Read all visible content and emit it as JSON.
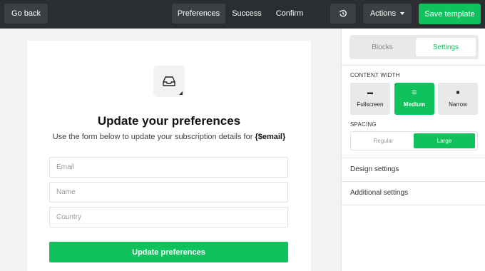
{
  "topbar": {
    "go_back": "Go back",
    "tabs": [
      {
        "label": "Preferences",
        "active": true
      },
      {
        "label": "Success",
        "active": false
      },
      {
        "label": "Confirm",
        "active": false
      }
    ],
    "actions": "Actions",
    "save": "Save template"
  },
  "canvas": {
    "icon": "inbox-icon",
    "title": "Update your preferences",
    "subtitle": "Use the form below to update your subscription details for",
    "subtitle_var": "{$email}",
    "fields": {
      "email": "Email",
      "name": "Name",
      "country": "Country"
    },
    "submit": "Update preferences"
  },
  "panel": {
    "tabs": {
      "blocks": "Blocks",
      "settings": "Settings"
    },
    "content_width_label": "CONTENT WIDTH",
    "content_width": {
      "fullscreen": "Fullscreen",
      "medium": "Medium",
      "narrow": "Narrow",
      "selected": "Medium"
    },
    "spacing_label": "SPACING",
    "spacing": {
      "regular": "Regular",
      "large": "Large",
      "selected": "Large"
    },
    "design_settings": "Design settings",
    "additional_settings": "Additional settings"
  },
  "colors": {
    "accent": "#10c25c",
    "topbar": "#2b2e30"
  }
}
